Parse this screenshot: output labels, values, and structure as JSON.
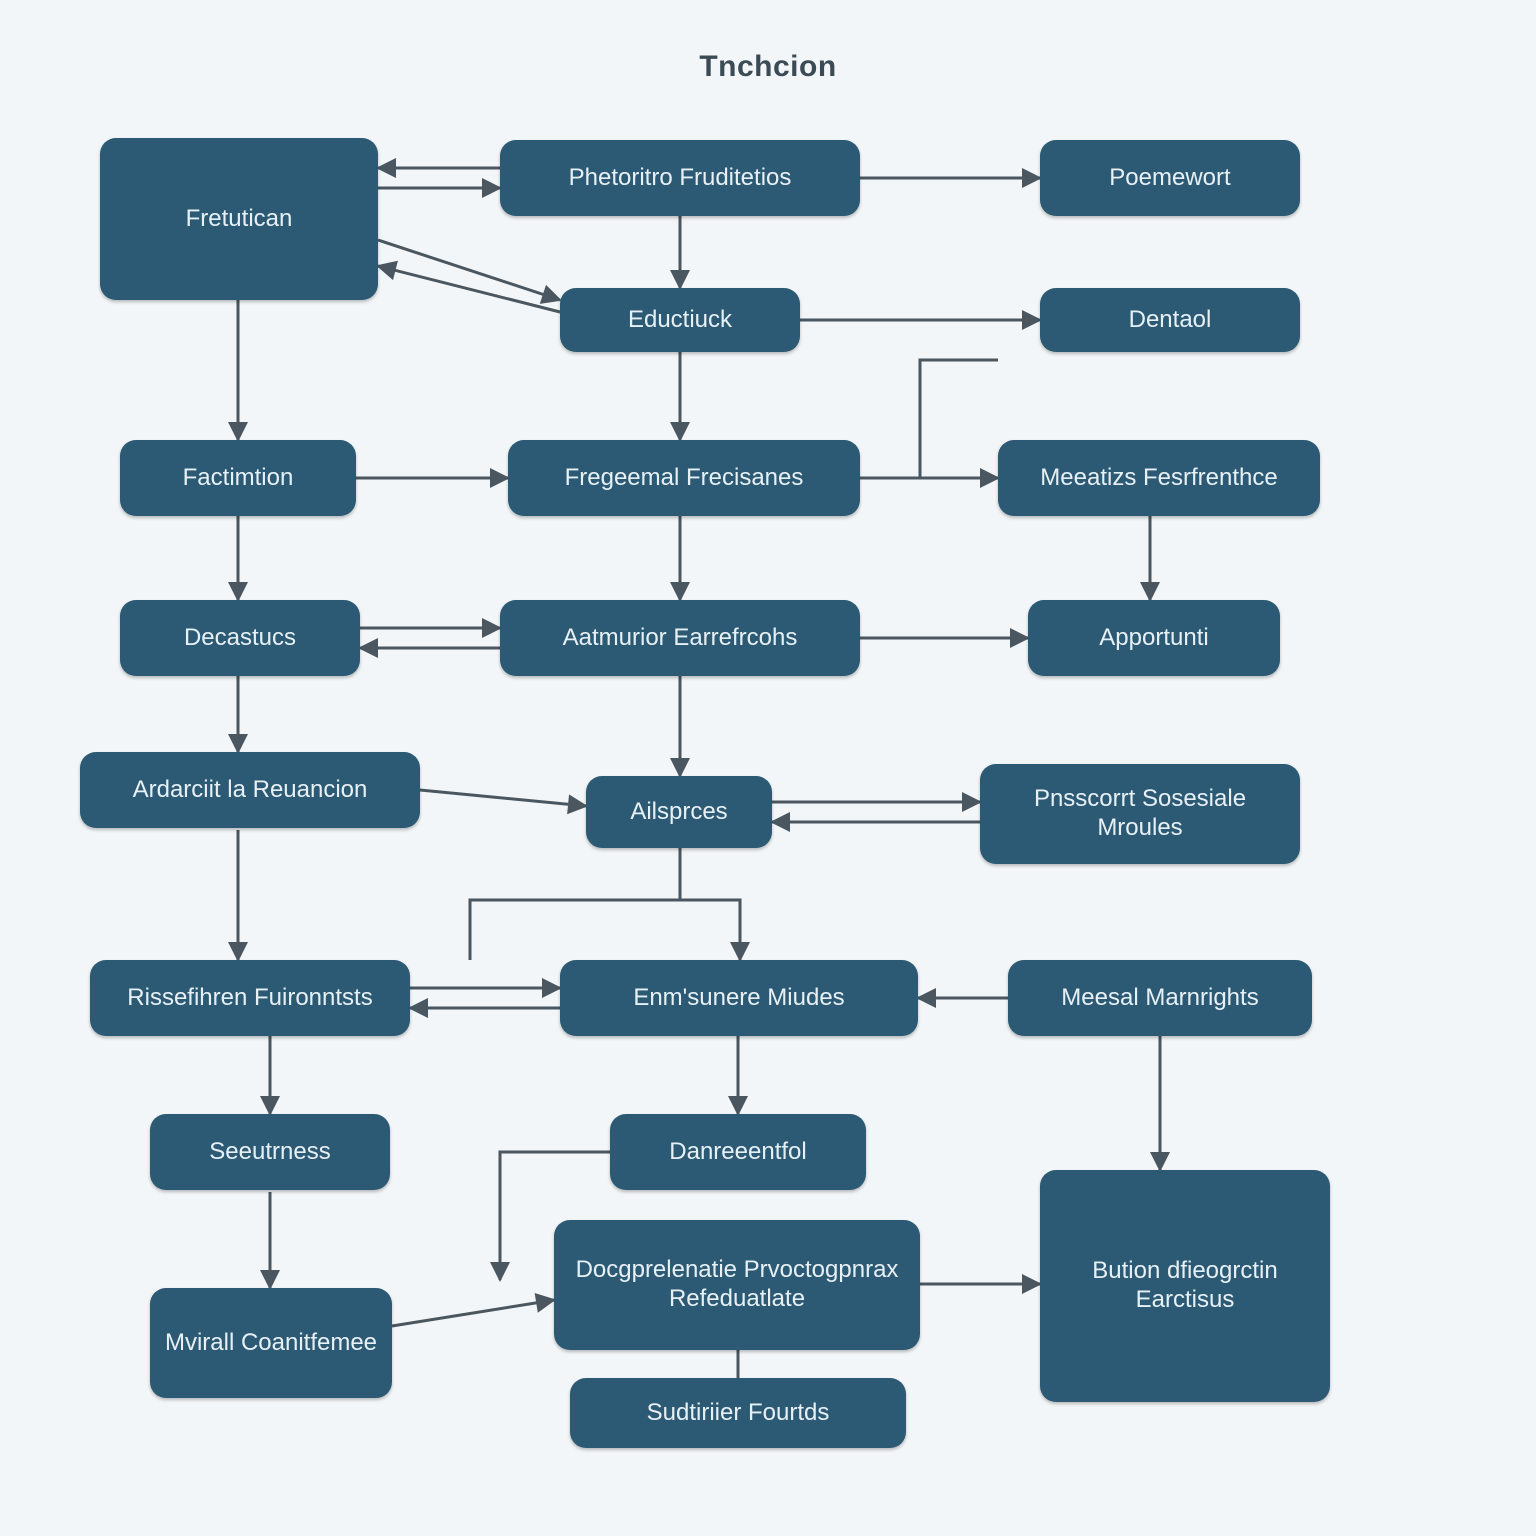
{
  "title": "Tnchcion",
  "colors": {
    "node_bg": "#2c5a74",
    "node_fg": "#e7f0f5",
    "edge": "#4a5760",
    "page_bg": "#f3f6f8"
  },
  "nodes": {
    "n1": {
      "label": "Phetoritro Fruditetios"
    },
    "n2": {
      "label": "Fretutican"
    },
    "n3": {
      "label": "Poemewort"
    },
    "n4": {
      "label": "Eductiuck"
    },
    "n5": {
      "label": "Dentaol"
    },
    "n6": {
      "label": "Factimtion"
    },
    "n7": {
      "label": "Fregeemal Frecisanes"
    },
    "n8": {
      "label": "Meeatizs Fesrfrenthce"
    },
    "n9": {
      "label": "Decastucs"
    },
    "n10": {
      "label": "Aatmurior Earrefrcohs"
    },
    "n11": {
      "label": "Apportunti"
    },
    "n12": {
      "label": "Ardarciit la Reuancion"
    },
    "n13": {
      "label": "Ailsprces"
    },
    "n14": {
      "label": "Pnsscorrt Sosesiale Mroules"
    },
    "n15": {
      "label": "Rissefihren Fuironntsts"
    },
    "n16": {
      "label": "Enm'sunere Miudes"
    },
    "n17": {
      "label": "Meesal Marnrights"
    },
    "n18": {
      "label": "Seeutrness"
    },
    "n19": {
      "label": "Danreeentfol"
    },
    "n20": {
      "label": "Docgprelenatie Prvoctogpnrax Refeduatlate"
    },
    "n21": {
      "label": "Bution dfieogrctin Earctisus"
    },
    "n22": {
      "label": "Mvirall Coanitfemee"
    },
    "n23": {
      "label": "Sudtiriier Fourtds"
    }
  },
  "edges": [
    {
      "from": "n1",
      "to": "n2",
      "double": true
    },
    {
      "from": "n1",
      "to": "n3"
    },
    {
      "from": "n1",
      "to": "n4"
    },
    {
      "from": "n4",
      "to": "n2",
      "double": true
    },
    {
      "from": "n4",
      "to": "n5"
    },
    {
      "from": "n4",
      "to": "n7"
    },
    {
      "from": "n2",
      "to": "n6"
    },
    {
      "from": "n6",
      "to": "n7"
    },
    {
      "from": "n7",
      "to": "n8",
      "via": "n4-right"
    },
    {
      "from": "n6",
      "to": "n9"
    },
    {
      "from": "n7",
      "to": "n10"
    },
    {
      "from": "n8",
      "to": "n11"
    },
    {
      "from": "n9",
      "to": "n10",
      "double": true
    },
    {
      "from": "n10",
      "to": "n11"
    },
    {
      "from": "n9",
      "to": "n12"
    },
    {
      "from": "n10",
      "to": "n13"
    },
    {
      "from": "n12",
      "to": "n13"
    },
    {
      "from": "n13",
      "to": "n14",
      "double": true
    },
    {
      "from": "n12",
      "to": "n15"
    },
    {
      "from": "n13",
      "to": "n16"
    },
    {
      "from": "n15",
      "to": "n16",
      "double": true
    },
    {
      "from": "n16",
      "to": "n17",
      "reverse": true
    },
    {
      "from": "n15",
      "to": "n18"
    },
    {
      "from": "n16",
      "to": "n19"
    },
    {
      "from": "n17",
      "to": "n21"
    },
    {
      "from": "n18",
      "to": "n22"
    },
    {
      "from": "n22",
      "to": "n20"
    },
    {
      "from": "n19",
      "to": "n20"
    },
    {
      "from": "n20",
      "to": "n21"
    },
    {
      "from": "n20",
      "to": "n23"
    }
  ]
}
